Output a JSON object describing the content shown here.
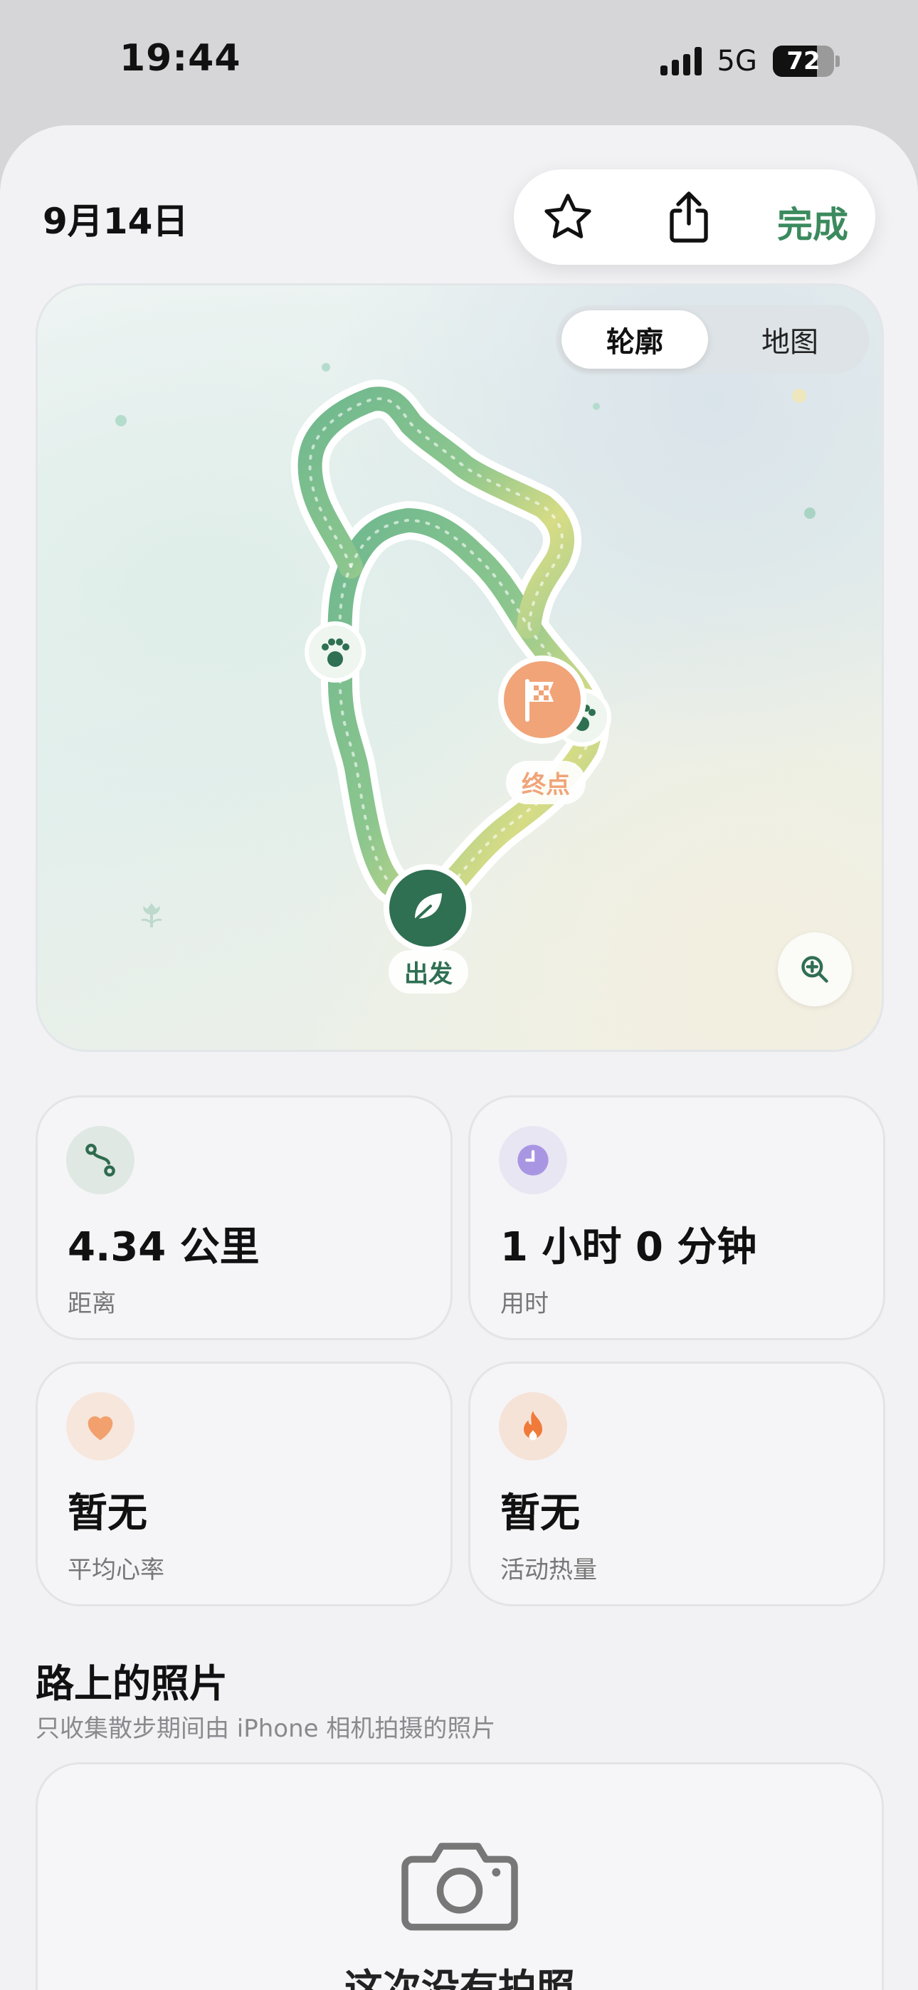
{
  "status_bar": {
    "time": "19:44",
    "network": "5G",
    "battery": "72",
    "battery_level": 0.72
  },
  "header": {
    "date": "9月14日",
    "done_label": "完成",
    "star_icon": "star-icon",
    "share_icon": "share-icon"
  },
  "map": {
    "segment": {
      "active": "轮廓",
      "inactive": "地图"
    },
    "start_label": "出发",
    "end_label": "终点",
    "zoom_icon": "zoom-in-icon"
  },
  "stats": [
    {
      "value": "4.34 公里",
      "label": "距离",
      "icon": "route-icon",
      "icon_bg": "#dfe8e3",
      "icon_color": "#2f6b4e"
    },
    {
      "value": "1 小时 0 分钟",
      "label": "用时",
      "icon": "clock-icon",
      "icon_bg": "#e9e6f3",
      "icon_color": "#a996e3"
    },
    {
      "value": "暂无",
      "label": "平均心率",
      "icon": "heart-icon",
      "icon_bg": "#f6e6dc",
      "icon_color": "#f2a06d"
    },
    {
      "value": "暂无",
      "label": "活动热量",
      "icon": "flame-icon",
      "icon_bg": "#f6e3d8",
      "icon_color": "#f07a3a"
    }
  ],
  "photos": {
    "title": "路上的照片",
    "subtitle": "只收集散步期间由 iPhone 相机拍摄的照片",
    "empty_text": "这次没有拍照",
    "camera_icon": "camera-icon"
  },
  "colors": {
    "accent": "#3b8a5e",
    "start_marker": "#2f6f52",
    "end_marker": "#f0a478"
  }
}
